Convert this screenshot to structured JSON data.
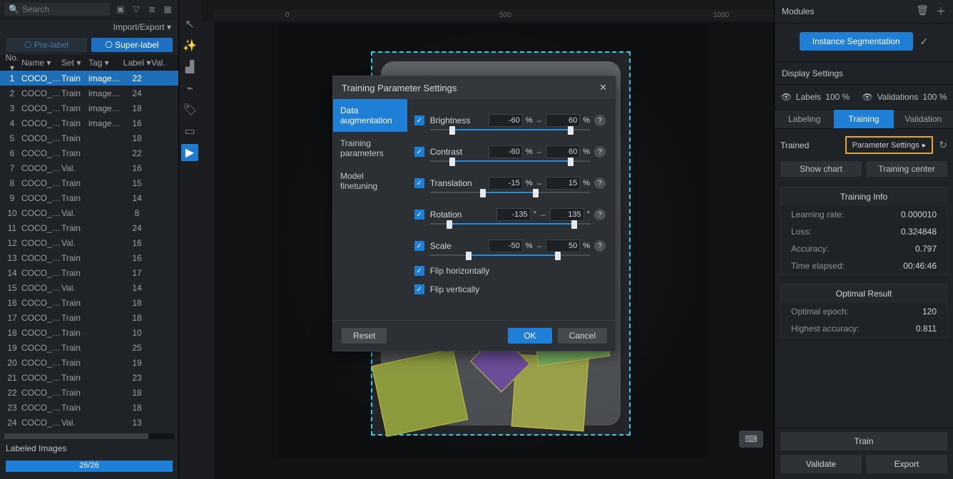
{
  "left": {
    "search_placeholder": "Search",
    "import_export": "Import/Export ▾",
    "prelabel": "⎔  Pre-label",
    "superlabel": "⎔  Super-label",
    "headers": {
      "no": "No. ▾",
      "name": "Name ▾",
      "set": "Set ▾",
      "tag": "Tag ▾",
      "label": "Label ▾",
      "val": "Val."
    },
    "rows": [
      {
        "no": "1",
        "name": "COCO_v...",
        "set": "Train",
        "tag": "image_...",
        "label": "22",
        "sel": true
      },
      {
        "no": "2",
        "name": "COCO_v...",
        "set": "Train",
        "tag": "image_...",
        "label": "24"
      },
      {
        "no": "3",
        "name": "COCO_v...",
        "set": "Train",
        "tag": "image_...",
        "label": "18"
      },
      {
        "no": "4",
        "name": "COCO_v...",
        "set": "Train",
        "tag": "image_...",
        "label": "16"
      },
      {
        "no": "5",
        "name": "COCO_v...",
        "set": "Train",
        "tag": "",
        "label": "18"
      },
      {
        "no": "6",
        "name": "COCO_v...",
        "set": "Train",
        "tag": "",
        "label": "22"
      },
      {
        "no": "7",
        "name": "COCO_v...",
        "set": "Val.",
        "tag": "",
        "label": "16"
      },
      {
        "no": "8",
        "name": "COCO_v...",
        "set": "Train",
        "tag": "",
        "label": "15"
      },
      {
        "no": "9",
        "name": "COCO_v...",
        "set": "Train",
        "tag": "",
        "label": "14"
      },
      {
        "no": "10",
        "name": "COCO_v...",
        "set": "Val.",
        "tag": "",
        "label": "8"
      },
      {
        "no": "11",
        "name": "COCO_v...",
        "set": "Train",
        "tag": "",
        "label": "24"
      },
      {
        "no": "12",
        "name": "COCO_v...",
        "set": "Val.",
        "tag": "",
        "label": "16"
      },
      {
        "no": "13",
        "name": "COCO_v...",
        "set": "Train",
        "tag": "",
        "label": "16"
      },
      {
        "no": "14",
        "name": "COCO_v...",
        "set": "Train",
        "tag": "",
        "label": "17"
      },
      {
        "no": "15",
        "name": "COCO_v...",
        "set": "Val.",
        "tag": "",
        "label": "14"
      },
      {
        "no": "16",
        "name": "COCO_v...",
        "set": "Train",
        "tag": "",
        "label": "18"
      },
      {
        "no": "17",
        "name": "COCO_v...",
        "set": "Train",
        "tag": "",
        "label": "18"
      },
      {
        "no": "18",
        "name": "COCO_v...",
        "set": "Train",
        "tag": "",
        "label": "10"
      },
      {
        "no": "19",
        "name": "COCO_v...",
        "set": "Train",
        "tag": "",
        "label": "25"
      },
      {
        "no": "20",
        "name": "COCO_v...",
        "set": "Train",
        "tag": "",
        "label": "19"
      },
      {
        "no": "21",
        "name": "COCO_v...",
        "set": "Train",
        "tag": "",
        "label": "23"
      },
      {
        "no": "22",
        "name": "COCO_v...",
        "set": "Train",
        "tag": "",
        "label": "18"
      },
      {
        "no": "23",
        "name": "COCO_v...",
        "set": "Train",
        "tag": "",
        "label": "18"
      },
      {
        "no": "24",
        "name": "COCO_v...",
        "set": "Val.",
        "tag": "",
        "label": "13"
      }
    ],
    "labeled_images": "Labeled Images",
    "progress_text": "26/26"
  },
  "center": {
    "tool_label": "Select Tool",
    "ruler": {
      "t0": "0",
      "t500": "500",
      "t1000": "1000"
    }
  },
  "modal": {
    "title": "Training Parameter Settings",
    "tabs": {
      "aug": "Data augmentation",
      "params": "Training parameters",
      "finetune": "Model finetuning"
    },
    "items": {
      "brightness": {
        "label": "Brightness",
        "min": "-60",
        "max": "60",
        "unit": "%",
        "range": [
          14,
          88
        ]
      },
      "contrast": {
        "label": "Contrast",
        "min": "-60",
        "max": "60",
        "unit": "%",
        "range": [
          14,
          88
        ]
      },
      "translation": {
        "label": "Translation",
        "min": "-15",
        "max": "15",
        "unit": "%",
        "range": [
          33,
          66
        ]
      },
      "rotation": {
        "label": "Rotation",
        "min": "-135",
        "max": "135",
        "unit": "°",
        "range": [
          12,
          90
        ]
      },
      "scale": {
        "label": "Scale",
        "min": "-50",
        "max": "50",
        "unit": "%",
        "range": [
          24,
          80
        ]
      },
      "fliph": "Flip horizontally",
      "flipv": "Flip vertically"
    },
    "reset": "Reset",
    "ok": "OK",
    "cancel": "Cancel"
  },
  "right": {
    "modules": "Modules",
    "module_pill": "Instance Segmentation",
    "display_settings": "Display Settings",
    "labels": "Labels",
    "labels_pct": "100 %",
    "validations": "Validations",
    "val_pct": "100 %",
    "tabs": {
      "labeling": "Labeling",
      "training": "Training",
      "validation": "Validation"
    },
    "trained": "Trained",
    "param_settings": "Parameter Settings",
    "show_chart": "Show chart",
    "training_center": "Training center",
    "info": {
      "title": "Training Info",
      "lr": {
        "k": "Learning rate:",
        "v": "0.000010"
      },
      "loss": {
        "k": "Loss:",
        "v": "0.324848"
      },
      "acc": {
        "k": "Accuracy:",
        "v": "0.797"
      },
      "time": {
        "k": "Time elapsed:",
        "v": "00:46:46"
      }
    },
    "optimal": {
      "title": "Optimal Result",
      "epoch": {
        "k": "Optimal epoch:",
        "v": "120"
      },
      "hacc": {
        "k": "Highest accuracy:",
        "v": "0.811"
      }
    },
    "train": "Train",
    "validate": "Validate",
    "export": "Export"
  }
}
